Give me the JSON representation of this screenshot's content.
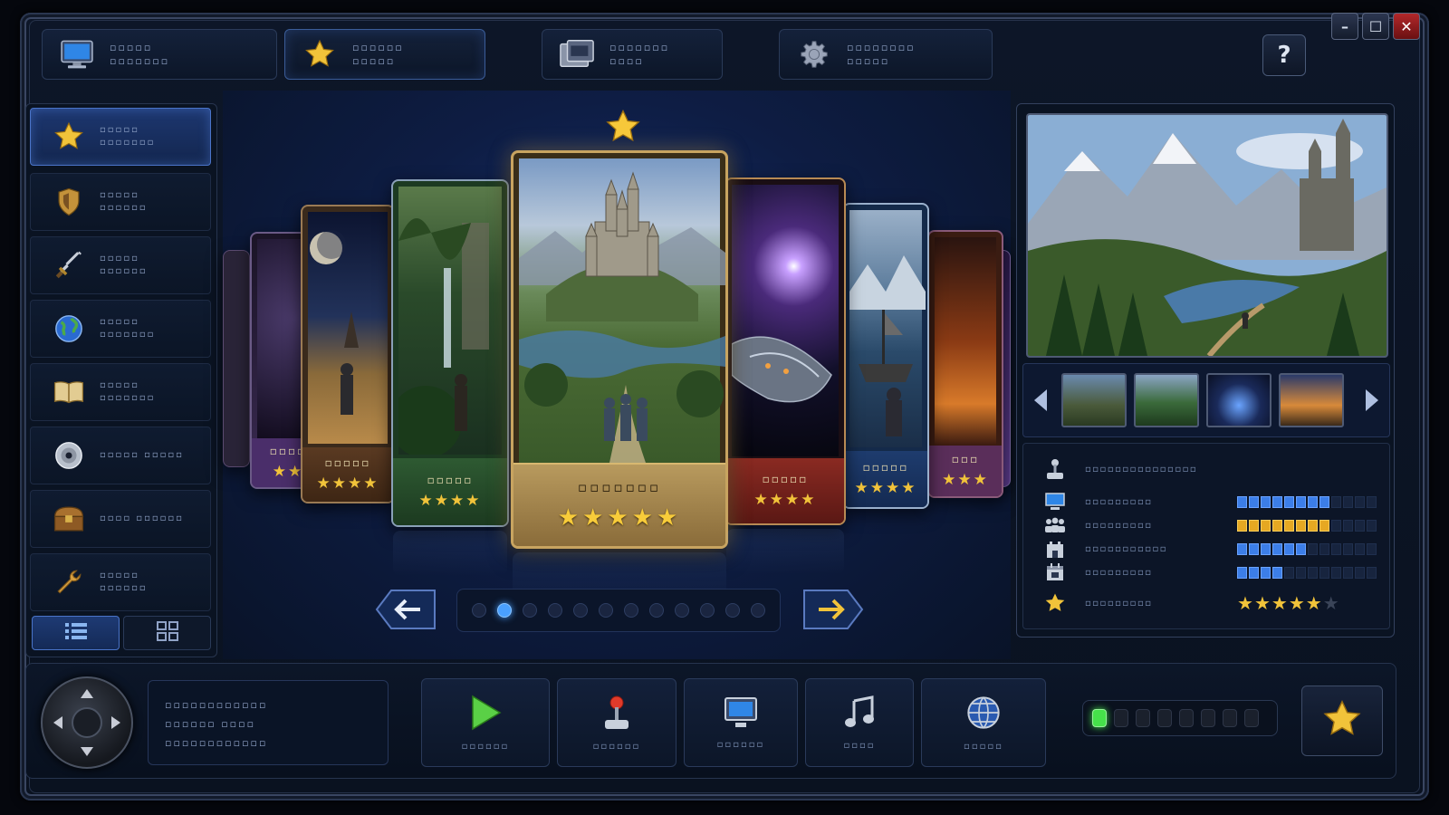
{
  "window": {
    "minimize_glyph": "–",
    "maximize_glyph": "☐",
    "close_glyph": "✕"
  },
  "top_tabs": [
    {
      "icon": "monitor-icon",
      "label": "▫▫▫▫▫ ▫▫▫▫▫▫▫"
    },
    {
      "icon": "star-icon",
      "label": "▫▫▫▫▫▫ ▫▫▫▫▫"
    },
    {
      "icon": "folder-icon",
      "label": "▫▫▫▫▫▫▫ ▫▫▫▫"
    },
    {
      "icon": "gear-icon",
      "label": "▫▫▫▫▫▫▫▫ ▫▫▫▫▫"
    }
  ],
  "help_label": "?",
  "sidebar": {
    "items": [
      {
        "icon": "star-icon",
        "label": "▫▫▫▫▫ ▫▫▫▫▫▫▫"
      },
      {
        "icon": "shield-icon",
        "label": "▫▫▫▫▫ ▫▫▫▫▫▫"
      },
      {
        "icon": "sword-icon",
        "label": "▫▫▫▫▫ ▫▫▫▫▫▫"
      },
      {
        "icon": "globe-icon",
        "label": "▫▫▫▫▫ ▫▫▫▫▫▫▫"
      },
      {
        "icon": "book-icon",
        "label": "▫▫▫▫▫ ▫▫▫▫▫▫▫"
      },
      {
        "icon": "disc-icon",
        "label": "▫▫▫▫▫ ▫▫▫▫▫"
      },
      {
        "icon": "chest-icon",
        "label": "▫▫▫▫ ▫▫▫▫▫▫"
      },
      {
        "icon": "wrench-icon",
        "label": "▫▫▫▫▫ ▫▫▫▫▫▫"
      }
    ],
    "view_toggle": [
      {
        "icon": "list-view-icon"
      },
      {
        "icon": "grid-view-icon"
      }
    ]
  },
  "carousel": {
    "cards": [
      {
        "title": "▫▫▫▫",
        "stars": "★★",
        "theme": "purple"
      },
      {
        "title": "▫▫▫▫▫",
        "stars": "★★★★",
        "theme": "brown"
      },
      {
        "title": "▫▫▫▫▫",
        "stars": "★★★★",
        "theme": "green"
      },
      {
        "title": "▫▫▫▫▫▫▫",
        "stars": "★★★★★",
        "theme": "gold"
      },
      {
        "title": "▫▫▫▫▫",
        "stars": "★★★★",
        "theme": "red"
      },
      {
        "title": "▫▫▫▫▫",
        "stars": "★★★★",
        "theme": "blue"
      },
      {
        "title": "▫▫▫",
        "stars": "★★★",
        "theme": "violet"
      }
    ],
    "page_count": 12,
    "active_page": 2
  },
  "detail_panel": {
    "rating_label": "▫▫▫▫▫▫▫▫▫▫▫▫▫▫▫",
    "stats": [
      {
        "icon": "monitor-icon",
        "label": "▫▫▫▫▫▫▫▫▫",
        "value": 8,
        "max": 12,
        "color": "blue"
      },
      {
        "icon": "users-icon",
        "label": "▫▫▫▫▫▫▫▫▫",
        "value": 8,
        "max": 12,
        "color": "gold"
      },
      {
        "icon": "castle-icon",
        "label": "▫▫▫▫▫▫▫▫▫▫▫",
        "value": 6,
        "max": 12,
        "color": "blue"
      },
      {
        "icon": "calendar-icon",
        "label": "▫▫▫▫▫▫▫▫▫",
        "value": 4,
        "max": 12,
        "color": "blue"
      }
    ],
    "score_label": "▫▫▫▫▫▫▫▫▫",
    "score_stars": 5,
    "score_max": 6
  },
  "info_box": {
    "line1": "▫▫▫▫▫▫▫▫▫▫▫▫",
    "line2": "▫▫▫▫▫▫ ▫▫▫▫",
    "line3": "▫▫▫▫▫▫▫▫▫▫▫▫"
  },
  "actions": [
    {
      "icon": "play-icon",
      "label": "▫▫▫▫▫▫"
    },
    {
      "icon": "joystick-icon",
      "label": "▫▫▫▫▫▫"
    },
    {
      "icon": "monitor-icon",
      "label": "▫▫▫▫▫▫"
    },
    {
      "icon": "music-note-icon",
      "label": "▫▫▫▫"
    },
    {
      "icon": "globe-icon",
      "label": "▫▫▫▫▫"
    }
  ],
  "status_leds": {
    "count": 8,
    "active": 1
  },
  "colors": {
    "accent_blue": "#3c7ee8",
    "accent_gold": "#f1c33a",
    "led_green": "#46e04a",
    "close_red": "#b2282a"
  }
}
